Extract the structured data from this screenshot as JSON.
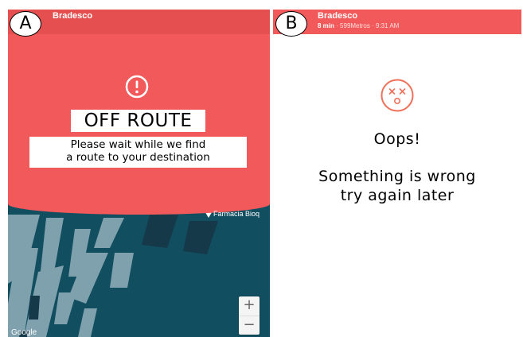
{
  "labels": {
    "a": "A",
    "b": "B"
  },
  "panel_a": {
    "app_title": "Bradesco",
    "alert_icon": "alert-circle-icon",
    "heading": "OFF ROUTE",
    "message_line1": "Please wait while we find",
    "message_line2": "a route to your destination",
    "map": {
      "poi_label": "Farmacia Bioq",
      "zoom_in": "+",
      "zoom_out": "−",
      "attribution": "Google",
      "colors": {
        "water": "#114e60",
        "land": "#7fa0ad",
        "buildings": "#16394a"
      }
    },
    "colors": {
      "banner": "#f2595a",
      "statusbar": "#e54f50"
    }
  },
  "panel_b": {
    "app_title": "Bradesco",
    "eta": "8 min",
    "distance": "599Metros",
    "time": "9:31 AM",
    "separator": "·",
    "face_icon": "dizzy-face-icon",
    "oops": "Oops!",
    "error_line1": "Something is wrong",
    "error_line2": "try again later",
    "colors": {
      "header": "#f2595a",
      "icon": "#f0705a"
    }
  }
}
